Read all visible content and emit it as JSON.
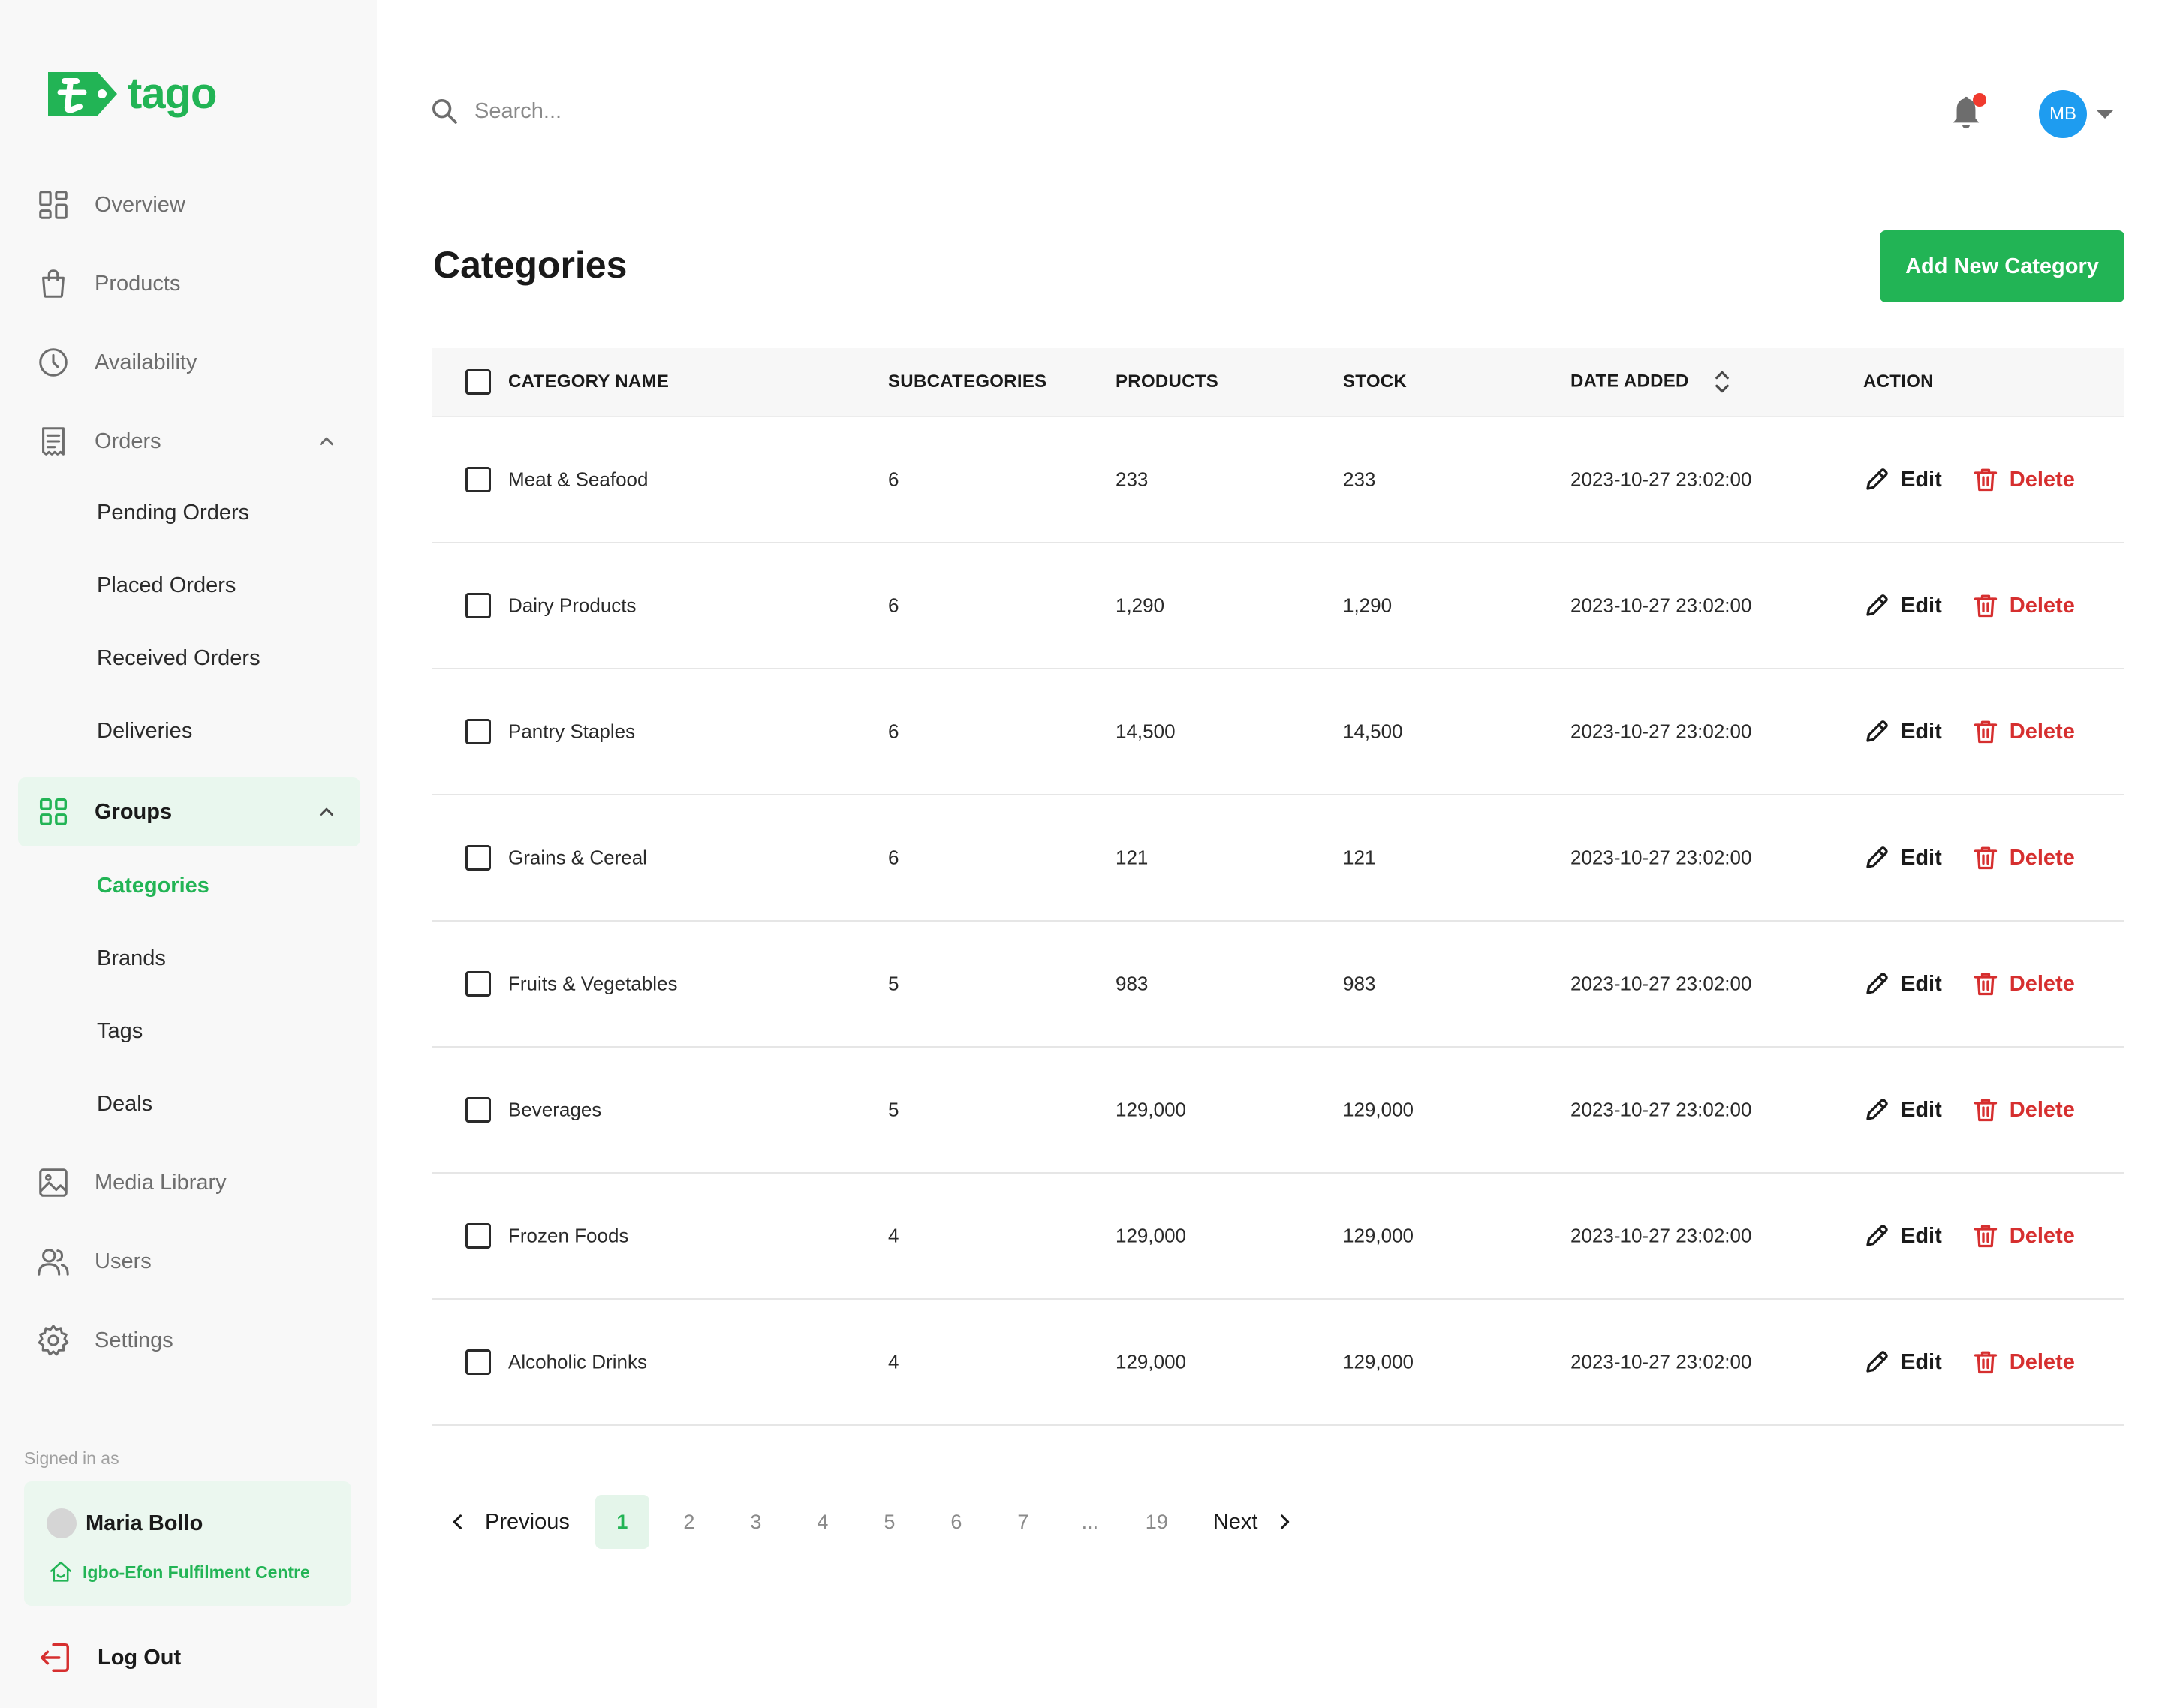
{
  "brand": {
    "name": "tago",
    "color": "#22b455"
  },
  "sidebar": {
    "nav": [
      {
        "label": "Overview",
        "icon": "dashboard-icon"
      },
      {
        "label": "Products",
        "icon": "shopping-bag-icon"
      },
      {
        "label": "Availability",
        "icon": "clock-icon"
      },
      {
        "label": "Orders",
        "icon": "receipt-icon",
        "expanded": true
      },
      {
        "label": "Groups",
        "icon": "grid-icon",
        "expanded": true,
        "active": true
      },
      {
        "label": "Media Library",
        "icon": "image-icon"
      },
      {
        "label": "Users",
        "icon": "users-icon"
      },
      {
        "label": "Settings",
        "icon": "gear-icon"
      }
    ],
    "orders_sub": [
      "Pending Orders",
      "Placed Orders",
      "Received Orders",
      "Deliveries"
    ],
    "groups_sub": [
      "Categories",
      "Brands",
      "Tags",
      "Deals"
    ],
    "selected_sub": "Categories",
    "signed_in_label": "Signed in as",
    "user": {
      "name": "Maria Bollo",
      "centre": "Igbo-Efon Fulfilment Centre"
    },
    "logout_label": "Log Out"
  },
  "topbar": {
    "search_placeholder": "Search...",
    "avatar_initials": "MB",
    "avatar_color": "#1e9cf0",
    "notification_dot_color": "#f03a2e"
  },
  "page": {
    "title": "Categories",
    "add_button": "Add New Category"
  },
  "table": {
    "headers": {
      "name": "CATEGORY NAME",
      "subcategories": "SUBCATEGORIES",
      "products": "PRODUCTS",
      "stock": "STOCK",
      "date": "DATE ADDED",
      "action": "ACTION"
    },
    "edit_label": "Edit",
    "delete_label": "Delete",
    "rows": [
      {
        "name": "Meat & Seafood",
        "subcategories": "6",
        "products": "233",
        "stock": "233",
        "date": "2023-10-27 23:02:00"
      },
      {
        "name": "Dairy Products",
        "subcategories": "6",
        "products": "1,290",
        "stock": "1,290",
        "date": "2023-10-27 23:02:00"
      },
      {
        "name": "Pantry Staples",
        "subcategories": "6",
        "products": "14,500",
        "stock": "14,500",
        "date": "2023-10-27 23:02:00"
      },
      {
        "name": "Grains & Cereal",
        "subcategories": "6",
        "products": "121",
        "stock": "121",
        "date": "2023-10-27 23:02:00"
      },
      {
        "name": "Fruits & Vegetables",
        "subcategories": "5",
        "products": "983",
        "stock": "983",
        "date": "2023-10-27 23:02:00"
      },
      {
        "name": "Beverages",
        "subcategories": "5",
        "products": "129,000",
        "stock": "129,000",
        "date": "2023-10-27 23:02:00"
      },
      {
        "name": "Frozen Foods",
        "subcategories": "4",
        "products": "129,000",
        "stock": "129,000",
        "date": "2023-10-27 23:02:00"
      },
      {
        "name": "Alcoholic Drinks",
        "subcategories": "4",
        "products": "129,000",
        "stock": "129,000",
        "date": "2023-10-27 23:02:00"
      }
    ]
  },
  "pagination": {
    "previous_label": "Previous",
    "next_label": "Next",
    "pages": [
      "1",
      "2",
      "3",
      "4",
      "5",
      "6",
      "7",
      "...",
      "19"
    ],
    "current": "1"
  }
}
